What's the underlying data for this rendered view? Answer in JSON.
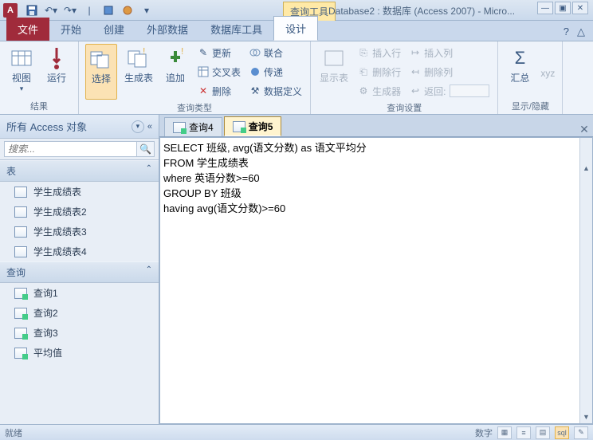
{
  "titlebar": {
    "app_letter": "A",
    "context_tab": "查询工具",
    "title": "Database2 : 数据库 (Access 2007) - Micro..."
  },
  "ribbon_tabs": {
    "file": "文件",
    "tabs": [
      "开始",
      "创建",
      "外部数据",
      "数据库工具",
      "设计"
    ],
    "active_index": 4
  },
  "ribbon": {
    "groups": {
      "results": {
        "name": "结果",
        "view": "视图",
        "run": "运行"
      },
      "query_type": {
        "name": "查询类型",
        "select": "选择",
        "make_table": "生成表",
        "append": "追加",
        "update": "更新",
        "crosstab": "交叉表",
        "delete": "删除",
        "union": "联合",
        "passthrough": "传递",
        "data_definition": "数据定义"
      },
      "query_setup": {
        "name": "查询设置",
        "show_table": "显示表",
        "insert_rows": "插入行",
        "delete_rows": "删除行",
        "builder": "生成器",
        "insert_cols": "插入列",
        "delete_cols": "删除列",
        "return": "返回:"
      },
      "show_hide": {
        "name": "显示/隐藏",
        "totals": "汇总"
      }
    }
  },
  "navpane": {
    "header": "所有 Access 对象",
    "search_placeholder": "搜索...",
    "categories": [
      {
        "name": "表",
        "items": [
          "学生成绩表",
          "学生成绩表2",
          "学生成绩表3",
          "学生成绩表4"
        ]
      },
      {
        "name": "查询",
        "items": [
          "查询1",
          "查询2",
          "查询3",
          "平均值"
        ]
      }
    ]
  },
  "documents": {
    "tabs": [
      "查询4",
      "查询5"
    ],
    "active_index": 1,
    "sql": "SELECT 班级, avg(语文分数) as 语文平均分\nFROM 学生成绩表\nwhere 英语分数>=60\nGROUP BY 班级\nhaving avg(语文分数)>=60"
  },
  "statusbar": {
    "left": "就绪",
    "right": "数字"
  }
}
